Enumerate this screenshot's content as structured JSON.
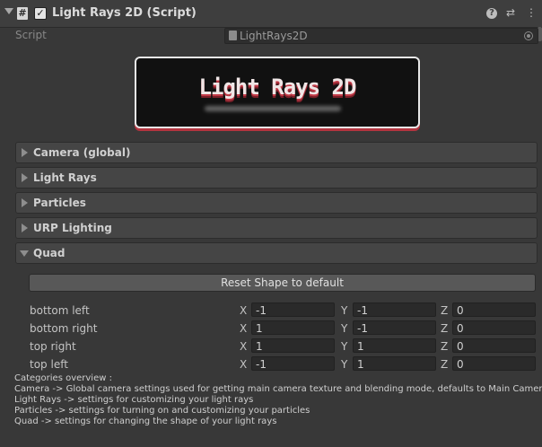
{
  "header": {
    "title": "Light Rays 2D (Script)",
    "script_icon_glyph": "#",
    "enabled": true,
    "icons": [
      "help-icon",
      "presets-icon",
      "context-menu-icon"
    ]
  },
  "script_row": {
    "label": "Script",
    "value": "LightRays2D"
  },
  "logo": {
    "text": "Light Rays 2D"
  },
  "foldouts": [
    {
      "label": "Camera (global)",
      "expanded": false
    },
    {
      "label": "Light Rays",
      "expanded": false
    },
    {
      "label": "Particles",
      "expanded": false
    },
    {
      "label": "URP Lighting",
      "expanded": false
    },
    {
      "label": "Quad",
      "expanded": true
    }
  ],
  "quad": {
    "reset_label": "Reset Shape to default",
    "axes": [
      "X",
      "Y",
      "Z"
    ],
    "vertices": [
      {
        "label": "bottom left",
        "x": "-1",
        "y": "-1",
        "z": "0"
      },
      {
        "label": "bottom right",
        "x": "1",
        "y": "-1",
        "z": "0"
      },
      {
        "label": "top right",
        "x": "1",
        "y": "1",
        "z": "0"
      },
      {
        "label": "top left",
        "x": "-1",
        "y": "1",
        "z": "0"
      }
    ]
  },
  "help_lines": [
    "Categories overview :",
    "Camera -> Global camera settings used for getting main camera texture and blending mode, defaults to Main Camera",
    "Light Rays -> settings for customizing your light rays",
    "Particles -> settings for turning on and customizing your particles",
    "Quad -> settings for changing the shape of your light rays"
  ],
  "colors": {
    "background": "#383838",
    "header": "#3e3e3e",
    "logo_accent": "#c23a47"
  }
}
